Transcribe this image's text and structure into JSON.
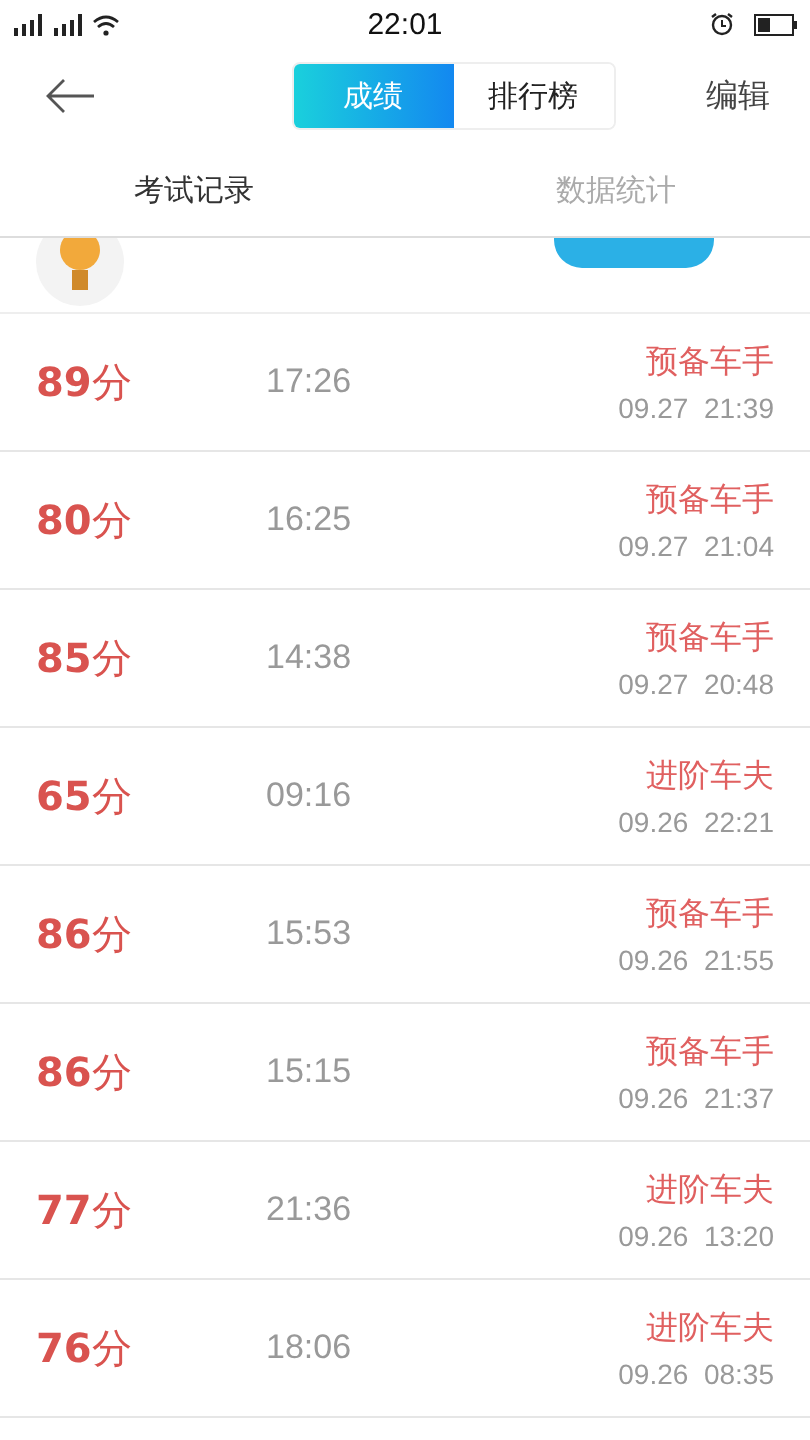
{
  "status_bar": {
    "time": "22:01"
  },
  "header": {
    "segments": [
      {
        "label": "成绩",
        "selected": true
      },
      {
        "label": "排行榜",
        "selected": false
      }
    ],
    "action": "编辑"
  },
  "tabs": [
    {
      "label": "考试记录",
      "selected": true
    },
    {
      "label": "数据统计",
      "selected": false
    }
  ],
  "records": [
    {
      "score": "**89**分",
      "duration": "17:26",
      "level": "预备车手",
      "date": "09.27  21:39"
    },
    {
      "score": "**80**分",
      "duration": "16:25",
      "level": "预备车手",
      "date": "09.27  21:04"
    },
    {
      "score": "**85**分",
      "duration": "14:38",
      "level": "预备车手",
      "date": "09.27  20:48"
    },
    {
      "score": "**65**分",
      "duration": "09:16",
      "level": "进阶车夫",
      "date": "09.26  22:21"
    },
    {
      "score": "**86**分",
      "duration": "15:53",
      "level": "预备车手",
      "date": "09.26  21:55"
    },
    {
      "score": "**86**分",
      "duration": "15:15",
      "level": "预备车手",
      "date": "09.26  21:37"
    },
    {
      "score": "**77**分",
      "duration": "21:36",
      "level": "进阶车夫",
      "date": "09.26  13:20"
    },
    {
      "score": "**76**分",
      "duration": "18:06",
      "level": "进阶车夫",
      "date": "09.26  08:35"
    }
  ]
}
